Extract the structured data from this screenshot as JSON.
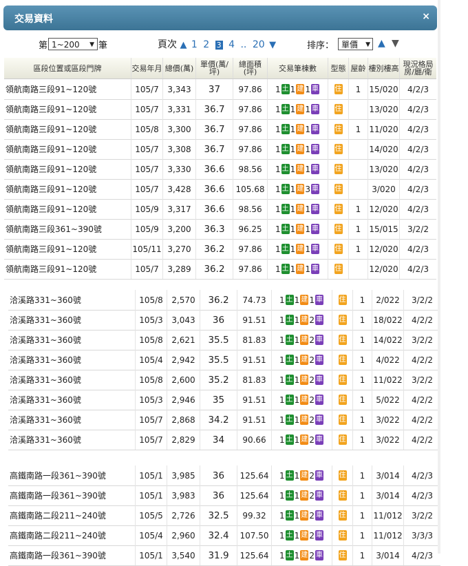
{
  "window": {
    "title": "交易資料",
    "close": "×"
  },
  "controls": {
    "range_prefix": "第",
    "range_value": "1~200",
    "range_suffix": "筆",
    "page_label": "頁次",
    "pages": [
      "1",
      "2",
      "3",
      "4",
      "..",
      "20"
    ],
    "current_page": "3",
    "sort_label": "排序：",
    "sort_value": "單價",
    "up": "▲",
    "down": "▼"
  },
  "headers": [
    "區段位置或區段門牌",
    "交易年月",
    "總價(萬)",
    "單價(萬/坪)",
    "總面積(坪)",
    "交易筆棟數",
    "型態",
    "屋齡",
    "樓別樓高",
    "現況格局房/廳/衛"
  ],
  "badges": {
    "land": "土",
    "bldg": "建",
    "car": "車",
    "use": "住"
  },
  "groups": [
    {
      "rows": [
        {
          "addr": "領航南路三段91~120號",
          "ym": "105/7",
          "total": "3,343",
          "unit": "37",
          "area": "97.86",
          "n1": "1",
          "n2": "1",
          "n3": "1",
          "age": "1",
          "floor": "15/020",
          "layout": "4/2/3"
        },
        {
          "addr": "領航南路三段91~120號",
          "ym": "105/7",
          "total": "3,331",
          "unit": "36.7",
          "area": "97.86",
          "n1": "1",
          "n2": "1",
          "n3": "1",
          "age": "",
          "floor": "13/020",
          "layout": "4/2/3"
        },
        {
          "addr": "領航南路三段91~120號",
          "ym": "105/8",
          "total": "3,300",
          "unit": "36.7",
          "area": "97.86",
          "n1": "1",
          "n2": "1",
          "n3": "1",
          "age": "1",
          "floor": "11/020",
          "layout": "4/2/3"
        },
        {
          "addr": "領航南路三段91~120號",
          "ym": "105/7",
          "total": "3,308",
          "unit": "36.7",
          "area": "97.86",
          "n1": "1",
          "n2": "1",
          "n3": "1",
          "age": "",
          "floor": "14/020",
          "layout": "4/2/3"
        },
        {
          "addr": "領航南路三段91~120號",
          "ym": "105/7",
          "total": "3,330",
          "unit": "36.6",
          "area": "98.56",
          "n1": "1",
          "n2": "1",
          "n3": "1",
          "age": "",
          "floor": "13/020",
          "layout": "4/2/3"
        },
        {
          "addr": "領航南路三段91~120號",
          "ym": "105/7",
          "total": "3,428",
          "unit": "36.6",
          "area": "105.68",
          "n1": "1",
          "n2": "1",
          "n3": "3",
          "age": "",
          "floor": "3/020",
          "layout": "4/2/3"
        },
        {
          "addr": "領航南路三段91~120號",
          "ym": "105/9",
          "total": "3,317",
          "unit": "36.6",
          "area": "98.56",
          "n1": "1",
          "n2": "1",
          "n3": "1",
          "age": "1",
          "floor": "12/020",
          "layout": "4/2/3"
        },
        {
          "addr": "領航南路三段361~390號",
          "ym": "105/9",
          "total": "3,200",
          "unit": "36.3",
          "area": "96.25",
          "n1": "1",
          "n2": "1",
          "n3": "1",
          "age": "1",
          "floor": "15/015",
          "layout": "3/2/2"
        },
        {
          "addr": "領航南路三段91~120號",
          "ym": "105/11",
          "total": "3,270",
          "unit": "36.2",
          "area": "97.86",
          "n1": "1",
          "n2": "1",
          "n3": "1",
          "age": "1",
          "floor": "12/020",
          "layout": "4/2/3"
        },
        {
          "addr": "領航南路三段91~120號",
          "ym": "105/7",
          "total": "3,289",
          "unit": "36.2",
          "area": "97.86",
          "n1": "1",
          "n2": "1",
          "n3": "1",
          "age": "",
          "floor": "12/020",
          "layout": "4/2/3"
        }
      ]
    },
    {
      "rows": [
        {
          "addr": "洽溪路331~360號",
          "ym": "105/8",
          "total": "2,570",
          "unit": "36.2",
          "area": "74.73",
          "n1": "1",
          "n2": "1",
          "n3": "1",
          "age": "1",
          "floor": "2/022",
          "layout": "3/2/2"
        },
        {
          "addr": "洽溪路331~360號",
          "ym": "105/3",
          "total": "3,043",
          "unit": "36",
          "area": "91.51",
          "n1": "1",
          "n2": "1",
          "n3": "2",
          "age": "1",
          "floor": "18/022",
          "layout": "4/2/2"
        },
        {
          "addr": "洽溪路331~360號",
          "ym": "105/8",
          "total": "2,621",
          "unit": "35.5",
          "area": "81.83",
          "n1": "1",
          "n2": "1",
          "n3": "2",
          "age": "1",
          "floor": "14/022",
          "layout": "3/2/2"
        },
        {
          "addr": "洽溪路331~360號",
          "ym": "105/4",
          "total": "2,942",
          "unit": "35.5",
          "area": "91.51",
          "n1": "1",
          "n2": "1",
          "n3": "2",
          "age": "1",
          "floor": "4/022",
          "layout": "4/2/2"
        },
        {
          "addr": "洽溪路331~360號",
          "ym": "105/8",
          "total": "2,600",
          "unit": "35.2",
          "area": "81.83",
          "n1": "1",
          "n2": "1",
          "n3": "2",
          "age": "1",
          "floor": "11/022",
          "layout": "3/2/2"
        },
        {
          "addr": "洽溪路331~360號",
          "ym": "105/3",
          "total": "2,946",
          "unit": "35",
          "area": "91.51",
          "n1": "1",
          "n2": "1",
          "n3": "2",
          "age": "1",
          "floor": "5/022",
          "layout": "4/2/2"
        },
        {
          "addr": "洽溪路331~360號",
          "ym": "105/7",
          "total": "2,868",
          "unit": "34.2",
          "area": "91.51",
          "n1": "1",
          "n2": "1",
          "n3": "2",
          "age": "1",
          "floor": "3/022",
          "layout": "4/2/2"
        },
        {
          "addr": "洽溪路331~360號",
          "ym": "105/7",
          "total": "2,829",
          "unit": "34",
          "area": "90.66",
          "n1": "1",
          "n2": "1",
          "n3": "2",
          "age": "1",
          "floor": "3/022",
          "layout": "4/2/2"
        }
      ]
    },
    {
      "rows": [
        {
          "addr": "高鐵南路一段361~390號",
          "ym": "105/1",
          "total": "3,985",
          "unit": "36",
          "area": "125.64",
          "n1": "1",
          "n2": "1",
          "n3": "2",
          "age": "1",
          "floor": "3/014",
          "layout": "4/2/3"
        },
        {
          "addr": "高鐵南路一段361~390號",
          "ym": "105/1",
          "total": "3,983",
          "unit": "36",
          "area": "125.64",
          "n1": "1",
          "n2": "1",
          "n3": "2",
          "age": "1",
          "floor": "3/014",
          "layout": "4/2/3"
        },
        {
          "addr": "高鐵南路二段211~240號",
          "ym": "105/5",
          "total": "2,726",
          "unit": "32.5",
          "area": "99.32",
          "n1": "1",
          "n2": "1",
          "n3": "2",
          "age": "1",
          "floor": "11/012",
          "layout": "3/2/2"
        },
        {
          "addr": "高鐵南路二段211~240號",
          "ym": "105/4",
          "total": "2,960",
          "unit": "32.4",
          "area": "107.50",
          "n1": "1",
          "n2": "1",
          "n3": "2",
          "age": "1",
          "floor": "11/012",
          "layout": "3/3/3"
        },
        {
          "addr": "高鐵南路一段361~390號",
          "ym": "105/1",
          "total": "3,540",
          "unit": "31.9",
          "area": "125.64",
          "n1": "1",
          "n2": "1",
          "n3": "2",
          "age": "1",
          "floor": "3/014",
          "layout": "4/2/3"
        }
      ]
    }
  ]
}
